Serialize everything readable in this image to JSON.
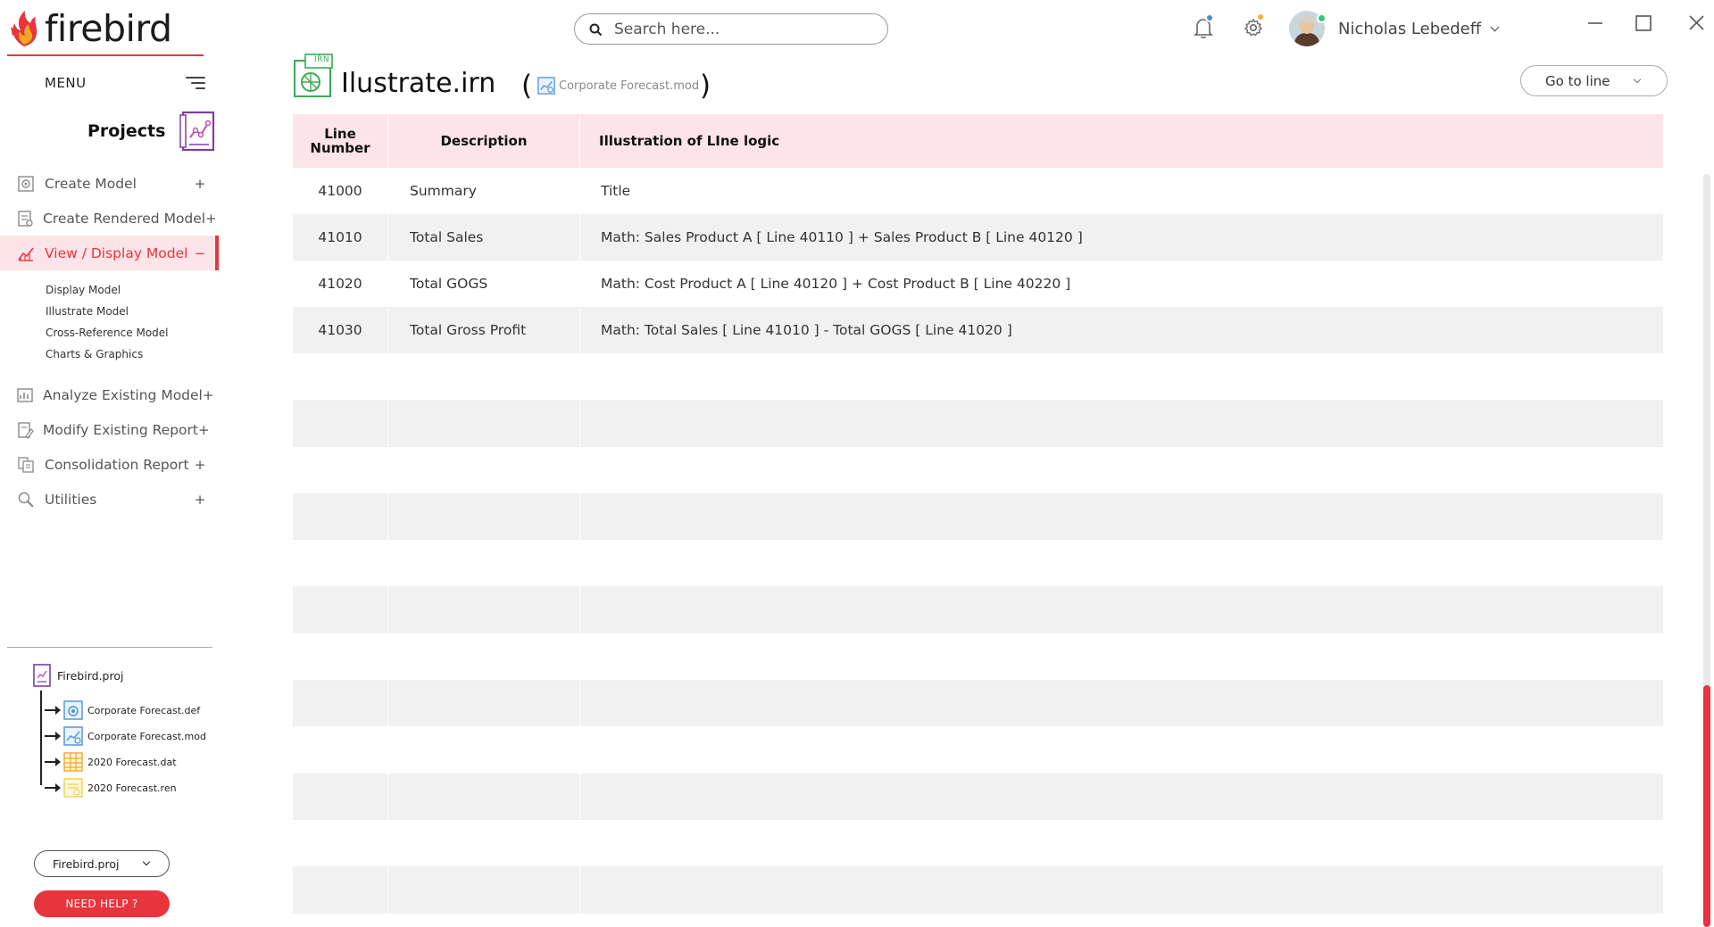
{
  "app": {
    "logo_text": "firebird"
  },
  "sidebar": {
    "menu_label": "MENU",
    "projects_label": "Projects",
    "nav": [
      {
        "label": "Create Model",
        "toggle": "+",
        "icon": "model-gear-icon"
      },
      {
        "label": "Create Rendered Model",
        "toggle": "+",
        "icon": "rendered-model-icon"
      },
      {
        "label": "View / Display Model",
        "toggle": "−",
        "icon": "line-chart-icon",
        "active": true
      },
      {
        "label": "Analyze Existing Model",
        "toggle": "+",
        "icon": "analyze-chart-icon"
      },
      {
        "label": "Modify Existing Report",
        "toggle": "+",
        "icon": "modify-report-icon"
      },
      {
        "label": "Consolidation Report",
        "toggle": "+",
        "icon": "consolidation-icon"
      },
      {
        "label": "Utilities",
        "toggle": "+",
        "icon": "utilities-icon"
      }
    ],
    "subnav": [
      "Display Model",
      "Illustrate Model",
      "Cross-Reference Model",
      "Charts & Graphics"
    ],
    "tree": {
      "root": "Firebird.proj",
      "children": [
        {
          "label": "Corporate Forecast.def",
          "icon": "def-file-icon",
          "color": "#4a90d9"
        },
        {
          "label": "Corporate Forecast.mod",
          "icon": "mod-file-icon",
          "color": "#4a90d9"
        },
        {
          "label": "2020 Forecast.dat",
          "icon": "dat-file-icon",
          "color": "#f5a623"
        },
        {
          "label": "2020 Forecast.ren",
          "icon": "ren-file-icon",
          "color": "#f0d050"
        }
      ]
    },
    "project_select": "Firebird.proj",
    "help_button": "NEED HELP ?"
  },
  "header": {
    "search_placeholder": "Search here...",
    "user_name": "Nicholas Lebedeff",
    "notification_dot_color": "#4a90d9",
    "settings_dot_color": "#f5b23a"
  },
  "page": {
    "doc_badge": "IRN",
    "title": "Ilustrate.irn",
    "paren_open": "(",
    "paren_close": ")",
    "model_ref": "Corporate Forecast.mod",
    "goto_label": "Go to line"
  },
  "table": {
    "headers": [
      "Line Number",
      "Description",
      "Illustration of LIne logic"
    ],
    "rows": [
      {
        "line": "41000",
        "desc": "Summary",
        "logic": "Title"
      },
      {
        "line": "41010",
        "desc": "Total Sales",
        "logic": "Math: Sales Product A [ Line 40110 ] + Sales Product B [ Line 40120 ]"
      },
      {
        "line": "41020",
        "desc": "Total GOGS",
        "logic": "Math: Cost Product A [ Line 40120 ] + Cost Product B [ Line 40220 ]"
      },
      {
        "line": "41030",
        "desc": "Total Gross Profit",
        "logic": "Math: Total Sales [ Line 41010 ] - Total GOGS [ Line 41020 ]"
      }
    ]
  },
  "colors": {
    "accent": "#e8343c",
    "header_bg": "#fde4e8",
    "row_alt": "#f1f1f2"
  }
}
